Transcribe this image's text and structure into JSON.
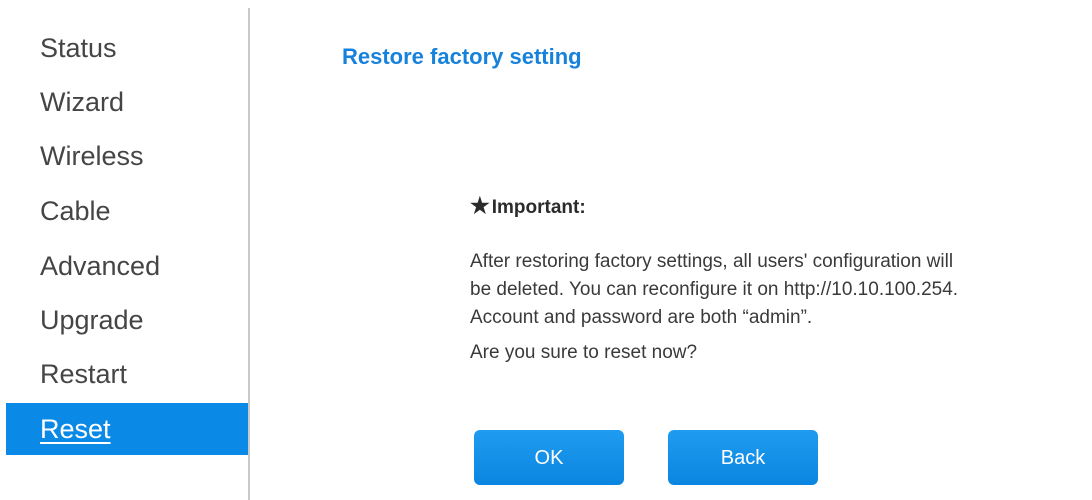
{
  "sidebar": {
    "items": [
      {
        "label": "Status"
      },
      {
        "label": "Wizard"
      },
      {
        "label": "Wireless"
      },
      {
        "label": "Cable"
      },
      {
        "label": "Advanced"
      },
      {
        "label": "Upgrade"
      },
      {
        "label": "Restart"
      },
      {
        "label": "Reset",
        "active": true
      }
    ]
  },
  "main": {
    "title": "Restore factory setting",
    "important_label": "Important:",
    "important_icon": "star-icon",
    "message_lines": [
      "After restoring factory settings, all users' configuration will",
      "be deleted. You can reconfigure it on http://10.10.100.254.",
      "Account and password are both “admin”."
    ],
    "question": "Are you sure to reset now?",
    "ok_label": "OK",
    "back_label": "Back"
  },
  "colors": {
    "accent": "#0a8ae6",
    "title": "#1782db",
    "text": "#3a3a3a"
  }
}
